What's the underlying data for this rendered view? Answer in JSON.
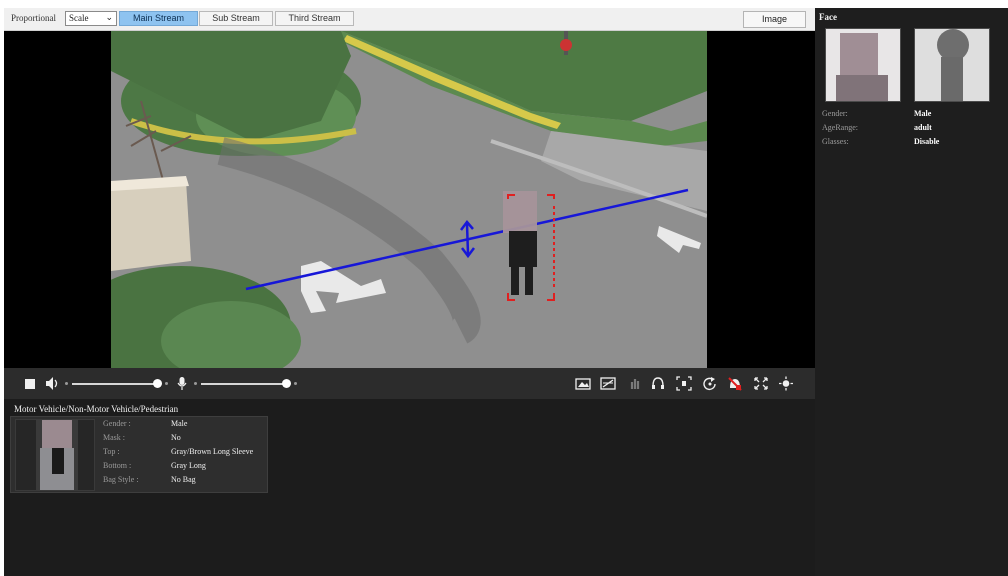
{
  "toolbar": {
    "proportional_label": "Proportional",
    "scale_value": "Scale",
    "streams": [
      "Main Stream",
      "Sub Stream",
      "Third Stream"
    ],
    "active_stream": "Main Stream",
    "image_button": "Image"
  },
  "lower_panel": {
    "title": "Motor Vehicle/Non-Motor Vehicle/Pedestrian",
    "attributes": [
      {
        "key": "Gender :",
        "value": "Male"
      },
      {
        "key": "Mask :",
        "value": "No"
      },
      {
        "key": "Top :",
        "value": "Gray/Brown Long Sleeve"
      },
      {
        "key": "Bottom :",
        "value": "Gray Long"
      },
      {
        "key": "Bag Style :",
        "value": "No Bag"
      }
    ]
  },
  "right_panel": {
    "title": "Face",
    "attributes": [
      {
        "key": "Gender:",
        "value": "Male"
      },
      {
        "key": "AgeRange:",
        "value": "adult"
      },
      {
        "key": "Glasses:",
        "value": "Disable"
      }
    ]
  },
  "colors": {
    "active_stream_bg": "#8ec3f0",
    "tripwire": "#1717d8",
    "detection_box": "#e02020",
    "panel_bg": "#1e1e1e",
    "controlbar_bg": "#2c2c2c"
  },
  "icons": {
    "controlbar_left": [
      "stop-icon",
      "speaker-icon",
      "microphone-icon"
    ],
    "controlbar_right": [
      "snapshot-icon",
      "record-icon",
      "ptz-icon",
      "audio-talk-icon",
      "digital-zoom-icon",
      "rotate-icon",
      "alarm-off-icon",
      "fullscreen-icon",
      "brightness-icon"
    ]
  }
}
